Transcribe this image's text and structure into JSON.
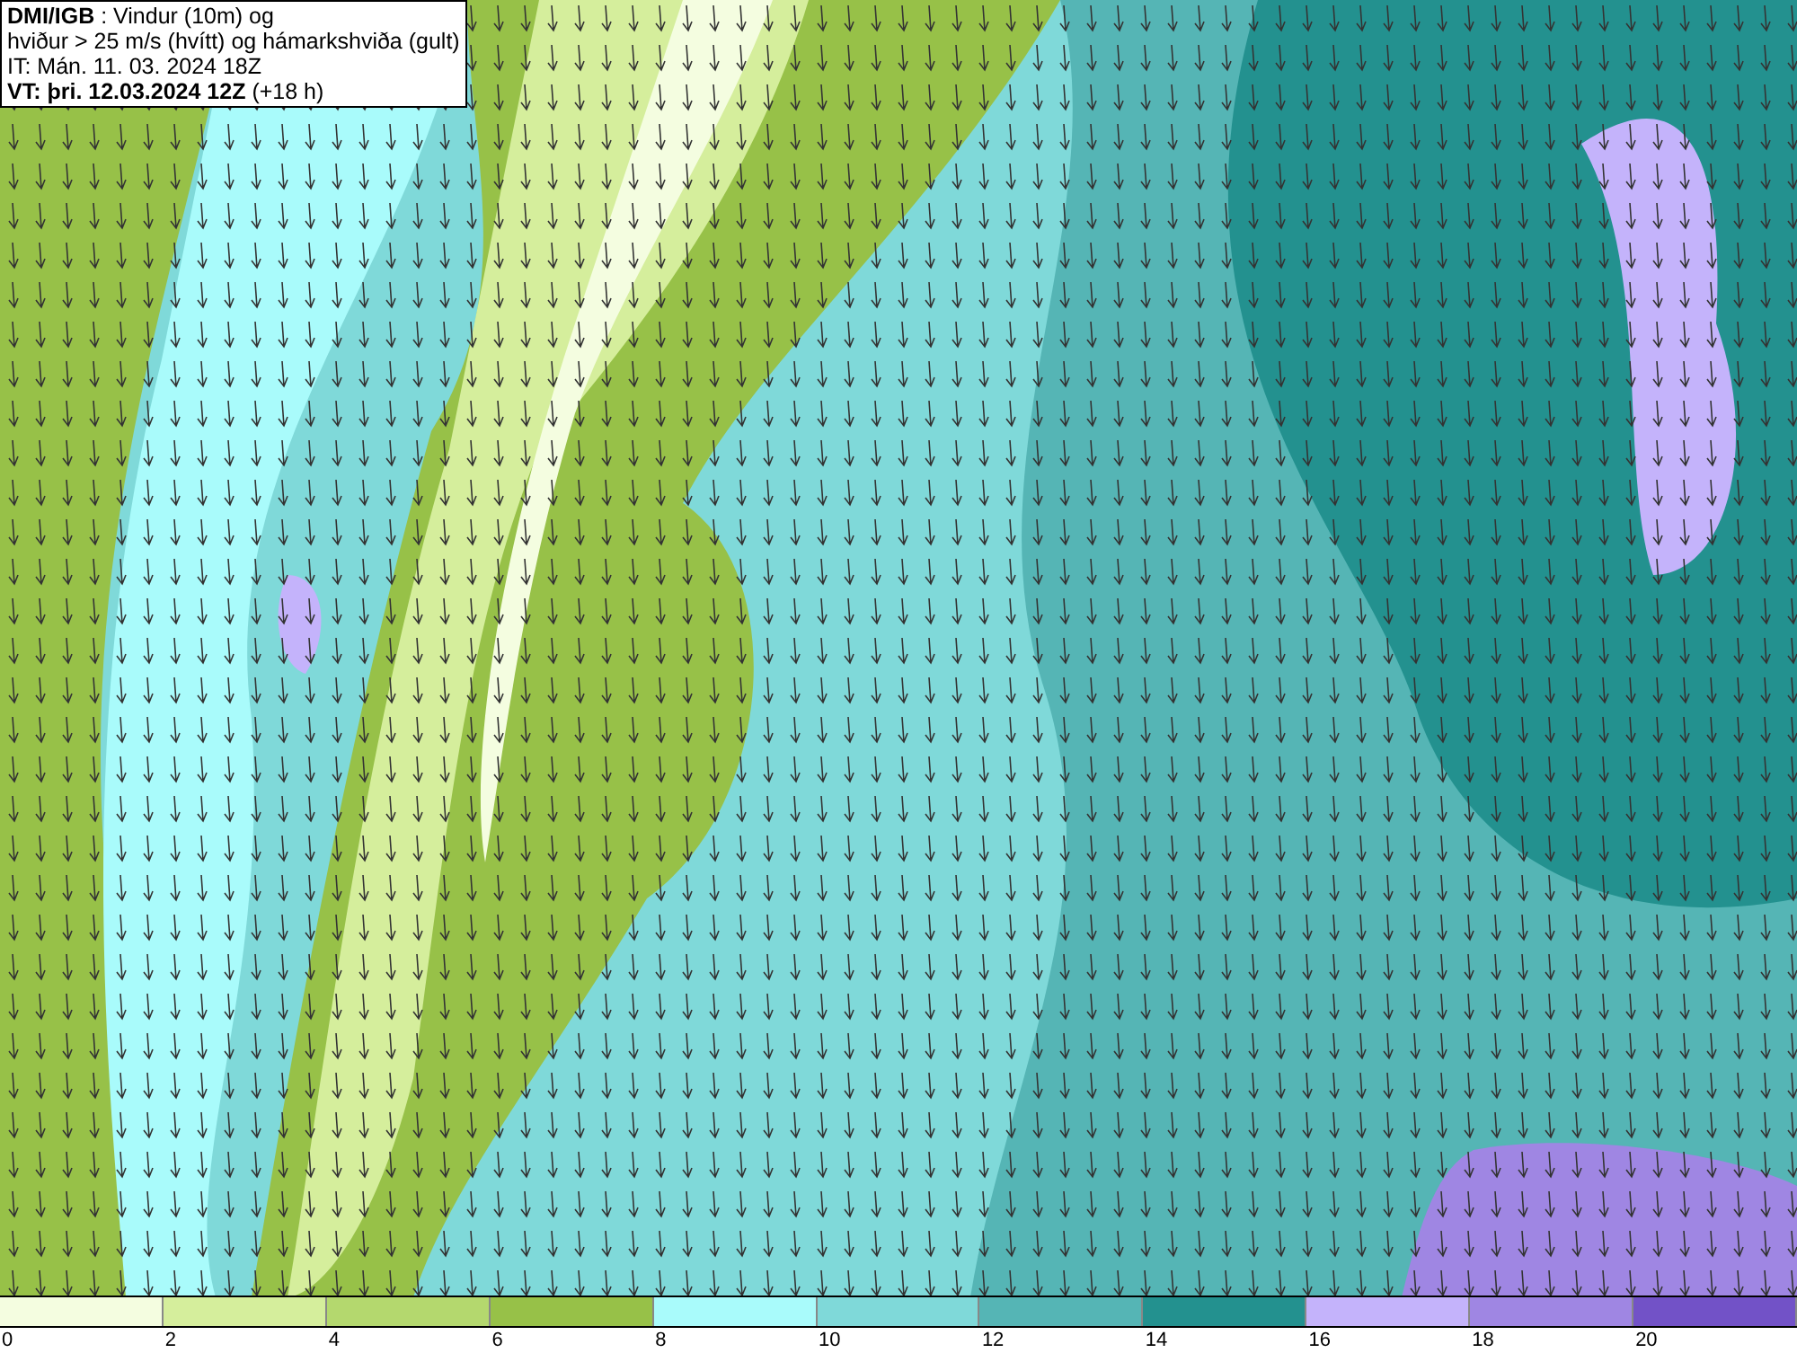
{
  "header": {
    "lines": [
      "**DMI/IGB** : Vindur (10m) og",
      "hviður > 25 m/s (hvítt) og hámarkshviða (gult)",
      "IT: Mán. 11. 03. 2024 18Z",
      "**VT: þri. 12.03.2024 12Z** (+18 h)"
    ]
  },
  "legend": {
    "bins": [
      {
        "label": "0",
        "color": "#f4fde0"
      },
      {
        "label": "2",
        "color": "#d5ee9c"
      },
      {
        "label": "4",
        "color": "#b4d86e"
      },
      {
        "label": "6",
        "color": "#97c148"
      },
      {
        "label": "8",
        "color": "#a9fbfb"
      },
      {
        "label": "10",
        "color": "#7fd9d9"
      },
      {
        "label": "12",
        "color": "#55b5b5"
      },
      {
        "label": "14",
        "color": "#23918f"
      },
      {
        "label": "16",
        "color": "#c4b3fb"
      },
      {
        "label": "18",
        "color": "#9f86e3"
      },
      {
        "label": "20",
        "color": "#7252c7"
      }
    ]
  }
}
